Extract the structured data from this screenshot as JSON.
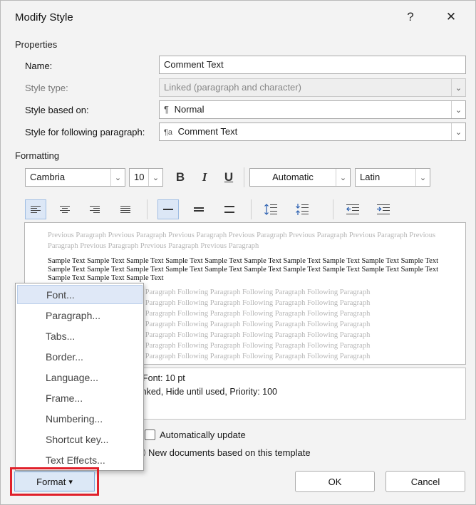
{
  "dialog": {
    "title": "Modify Style",
    "help_icon": "?",
    "close_icon": "✕"
  },
  "properties": {
    "section_label": "Properties",
    "name_label": "Name:",
    "name_value": "Comment Text",
    "style_type_label": "Style type:",
    "style_type_value": "Linked (paragraph and character)",
    "based_on_label": "Style based on:",
    "based_on_icon": "¶",
    "based_on_value": "Normal",
    "following_label": "Style for following paragraph:",
    "following_icon": "¶a",
    "following_value": "Comment Text"
  },
  "formatting": {
    "section_label": "Formatting",
    "font": "Cambria",
    "size": "10",
    "bold": "B",
    "italic": "I",
    "underline": "U",
    "color": "Automatic",
    "script": "Latin"
  },
  "preview": {
    "previous_text": "Previous Paragraph Previous Paragraph Previous Paragraph Previous Paragraph Previous Paragraph Previous Paragraph Previous Paragraph Previous Paragraph Previous Paragraph Previous Paragraph",
    "sample_text": "Sample Text Sample Text Sample Text Sample Text Sample Text Sample Text Sample Text Sample Text Sample Text Sample Text Sample Text Sample Text Sample Text Sample Text Sample Text Sample Text Sample Text Sample Text Sample Text Sample Text Sample Text Sample Text Sample Text",
    "following_lines": [
      "Following Paragraph Following Paragraph Following Paragraph Following Paragraph Following Paragraph",
      "Following Paragraph Following Paragraph Following Paragraph Following Paragraph Following Paragraph",
      "Following Paragraph Following Paragraph Following Paragraph Following Paragraph Following Paragraph",
      "Following Paragraph Following Paragraph Following Paragraph Following Paragraph Following Paragraph",
      "Following Paragraph Following Paragraph Following Paragraph Following Paragraph Following Paragraph",
      "Following Paragraph Following Paragraph Following Paragraph Following Paragraph Following Paragraph",
      "Following Paragraph Following Paragraph Following Paragraph Following Paragraph Following Paragraph"
    ]
  },
  "description": {
    "line1": "Font: 10 pt",
    "line2": "e: Linked, Hide until used, Priority: 100"
  },
  "options": {
    "auto_update_label": "Automatically update",
    "new_docs_label": "New documents based on this template"
  },
  "format_menu": {
    "items": [
      "Font...",
      "Paragraph...",
      "Tabs...",
      "Border...",
      "Language...",
      "Frame...",
      "Numbering...",
      "Shortcut key...",
      "Text Effects..."
    ]
  },
  "buttons": {
    "format": "Format",
    "format_arrow": "▾",
    "ok": "OK",
    "cancel": "Cancel"
  },
  "colors": {
    "highlight_border": "#e0202a",
    "selected_bg": "#dce7f6"
  }
}
